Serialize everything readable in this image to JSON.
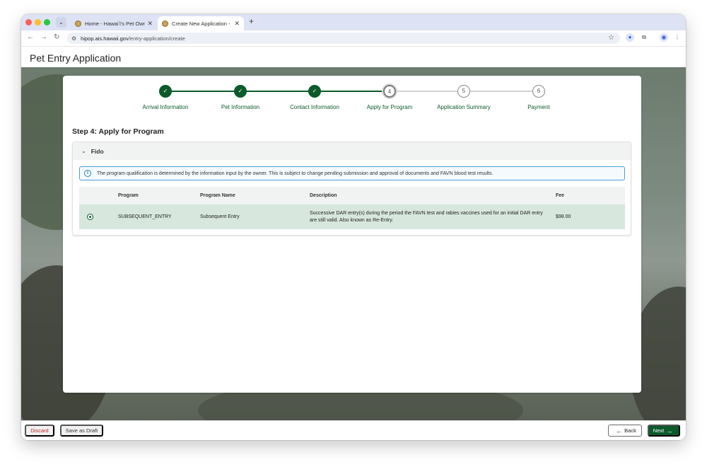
{
  "browser": {
    "tabs": [
      {
        "title": "Home - Hawaiʻi's Pet Owner Portal",
        "active": false
      },
      {
        "title": "Create New Application - Hawaiʻi's Pet Owner Portal",
        "active": true
      }
    ],
    "url_host": "hipop.ais.hawaii.gov",
    "url_path": "/entry-application/create"
  },
  "page": {
    "title": "Pet Entry Application"
  },
  "stepper": {
    "steps": [
      {
        "number": "✓",
        "label": "Arrival Information",
        "state": "done"
      },
      {
        "number": "✓",
        "label": "Pet Information",
        "state": "done"
      },
      {
        "number": "✓",
        "label": "Contact Information",
        "state": "done"
      },
      {
        "number": "4",
        "label": "Apply for Program",
        "state": "current"
      },
      {
        "number": "5",
        "label": "Application Summary",
        "state": "future"
      },
      {
        "number": "6",
        "label": "Payment",
        "state": "future"
      }
    ]
  },
  "step_heading": "Step 4: Apply for Program",
  "pet": {
    "name": "Fido",
    "info_message": "The program qualification is determined by the information input by the owner. This is subject to change pending submission and approval of documents and FAVN blood test results.",
    "table": {
      "headers": {
        "program": "Program",
        "program_name": "Program Name",
        "description": "Description",
        "fee": "Fee"
      },
      "rows": [
        {
          "program": "SUBSEQUENT_ENTRY",
          "program_name": "Subsequent Entry",
          "description": "Successive DAR entry(s) during the period the FAVN test and rabies vaccines used for an initial DAR entry are still valid. Also known as Re-Entry.",
          "fee": "$98.00",
          "selected": true
        }
      ]
    }
  },
  "footer": {
    "discard_label": "Discard",
    "save_draft_label": "Save as Draft",
    "back_label": "Back",
    "next_label": "Next"
  },
  "colors": {
    "primary_green": "#0b5a2a",
    "discard_red": "#c62828",
    "info_blue": "#4a9fd4",
    "selected_row": "#d7e7de"
  }
}
